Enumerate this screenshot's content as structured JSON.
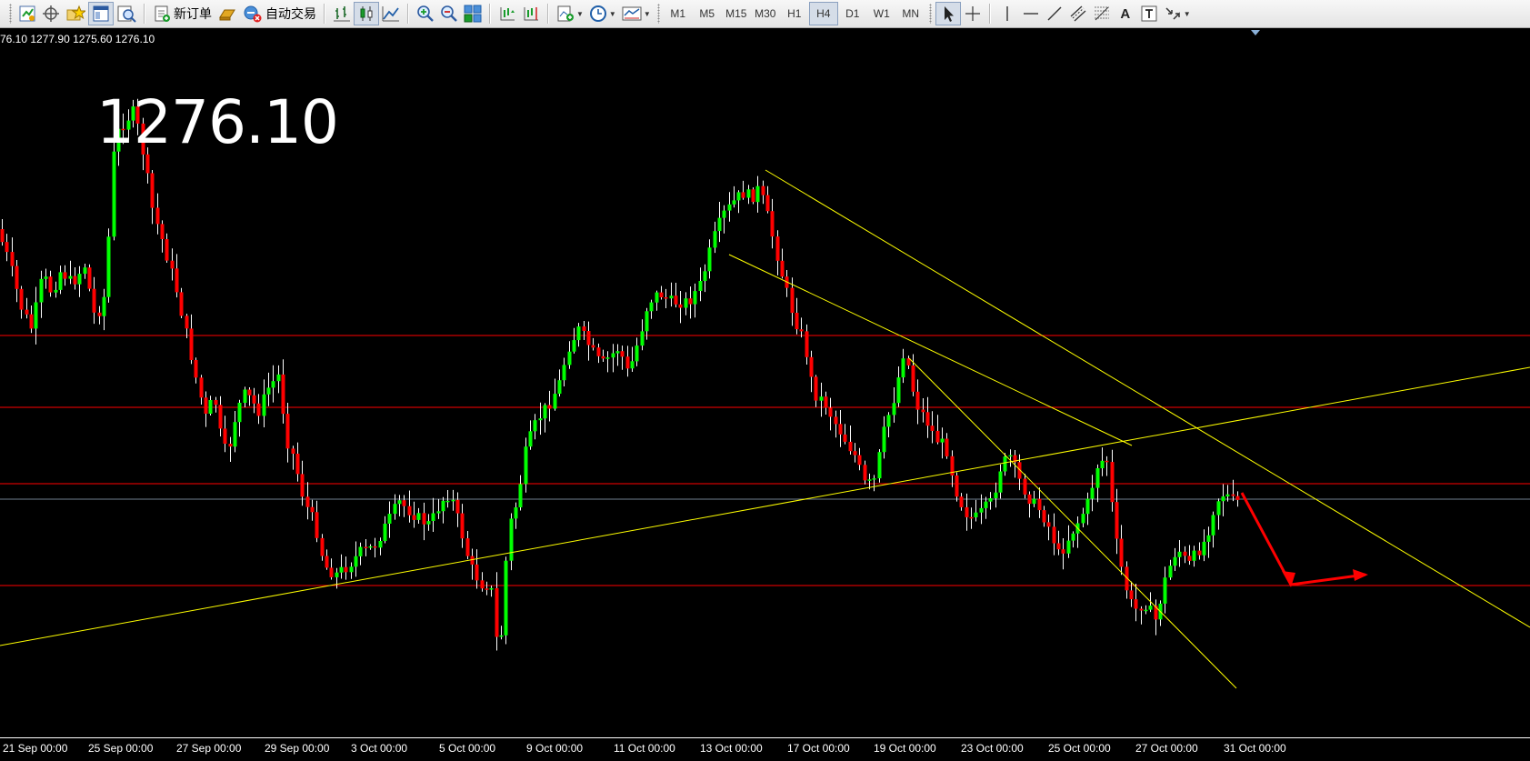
{
  "toolbar": {
    "new_order_label": "新订单",
    "auto_trade_label": "自动交易",
    "timeframes": [
      "M1",
      "M5",
      "M15",
      "M30",
      "H1",
      "H4",
      "D1",
      "W1",
      "MN"
    ],
    "active_timeframe": "H4",
    "text_tool_label": "A"
  },
  "chart": {
    "ohlc_readout": "76.10 1277.90 1275.60 1276.10",
    "current_price_display": "1276.10",
    "time_labels": [
      "21 Sep 00:00",
      "25 Sep 00:00",
      "27 Sep 00:00",
      "29 Sep 00:00",
      "3 Oct 00:00",
      "5 Oct 00:00",
      "9 Oct 00:00",
      "11 Oct 00:00",
      "13 Oct 00:00",
      "17 Oct 00:00",
      "19 Oct 00:00",
      "23 Oct 00:00",
      "25 Oct 00:00",
      "27 Oct 00:00",
      "31 Oct 00:00"
    ],
    "colors": {
      "background": "#000000",
      "bull_candle": "#00ff00",
      "bear_candle": "#ff0000",
      "wick": "#ffffff",
      "trendline": "#ffff00",
      "horizontal_line": "#ff0000",
      "price_line": "#708090",
      "arrow": "#ff0000"
    }
  }
}
